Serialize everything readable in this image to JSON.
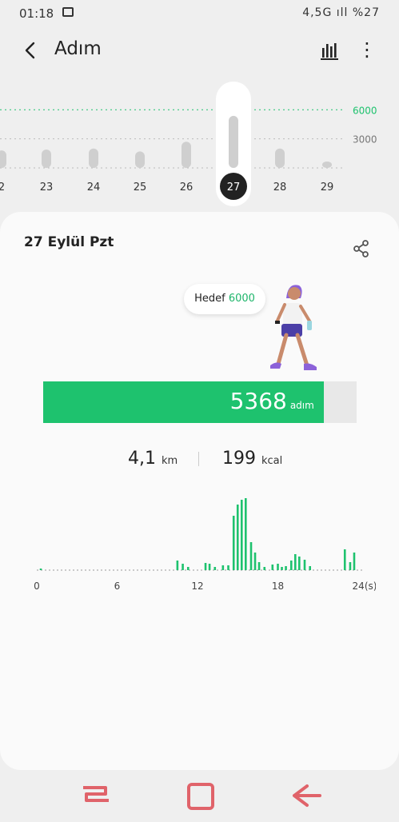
{
  "status": {
    "time": "01:18",
    "right_text": "4,5G ıll %27"
  },
  "header": {
    "title": "Adım"
  },
  "week_chart": {
    "goal_label": "6000",
    "mid_label": "3000",
    "goal": 6000,
    "max": 6600,
    "days": [
      {
        "label": "2",
        "value": 1800
      },
      {
        "label": "23",
        "value": 1900
      },
      {
        "label": "24",
        "value": 2000
      },
      {
        "label": "25",
        "value": 1700
      },
      {
        "label": "26",
        "value": 2700
      },
      {
        "label": "27",
        "value": 5368,
        "selected": true
      },
      {
        "label": "28",
        "value": 2000
      },
      {
        "label": "29",
        "value": 300
      }
    ]
  },
  "detail": {
    "date": "27 Eylül Pzt",
    "goal_text": "Hedef",
    "goal_value": "6000",
    "steps_value": "5368",
    "steps_unit": "adım",
    "progress": 0.895,
    "distance_value": "4,1",
    "distance_unit": "km",
    "calories_value": "199",
    "calories_unit": "kcal"
  },
  "hourly_chart": {
    "type": "bar",
    "x_ticks": [
      "0",
      "6",
      "12",
      "18",
      "24(s)"
    ],
    "hours_max": 24,
    "max": 90,
    "bars": [
      [
        0.3,
        2
      ],
      [
        10.5,
        12
      ],
      [
        10.9,
        8
      ],
      [
        11.3,
        4
      ],
      [
        12.6,
        9
      ],
      [
        12.9,
        8
      ],
      [
        13.3,
        4
      ],
      [
        13.9,
        6
      ],
      [
        14.3,
        6
      ],
      [
        14.7,
        68
      ],
      [
        15.0,
        82
      ],
      [
        15.3,
        88
      ],
      [
        15.6,
        90
      ],
      [
        16.0,
        35
      ],
      [
        16.3,
        22
      ],
      [
        16.6,
        10
      ],
      [
        17.0,
        4
      ],
      [
        17.6,
        7
      ],
      [
        18.0,
        8
      ],
      [
        18.3,
        4
      ],
      [
        18.6,
        5
      ],
      [
        19.0,
        12
      ],
      [
        19.3,
        20
      ],
      [
        19.6,
        17
      ],
      [
        20.0,
        13
      ],
      [
        20.4,
        5
      ],
      [
        23.0,
        26
      ],
      [
        23.4,
        10
      ],
      [
        23.7,
        22
      ]
    ]
  },
  "colors": {
    "accent": "#1ec26e",
    "nav": "#e0636a"
  }
}
